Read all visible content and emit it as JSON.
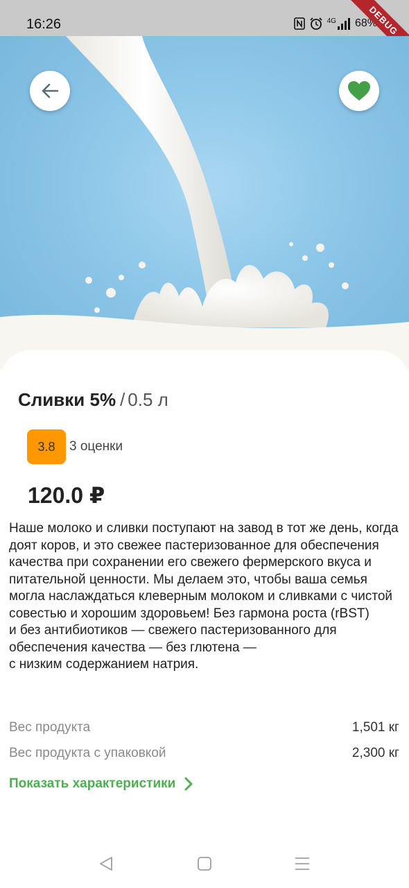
{
  "status_bar": {
    "time": "16:26",
    "network": "4G",
    "battery": "68%",
    "debug_label": "DEBUG",
    "icons": [
      "nfc-icon",
      "alarm-icon",
      "signal-icon",
      "battery-icon"
    ]
  },
  "hero": {
    "image": "milk-splash-image",
    "back_icon": "arrow-left-icon",
    "favorite_icon": "heart-icon"
  },
  "product": {
    "name": "Сливки 5%",
    "separator": "/",
    "volume": "0.5 л",
    "rating": "3.8",
    "rating_count": "3 оценки",
    "price": "120.0 ₽",
    "description": "Наше молоко и сливки поступают на завод в тот же день, когда доят коров, и это свежее пастеризованное для обеспечения качества при сохранении его свежего фермерского вкуса и питательной ценности. Мы делаем это, чтобы ваша семья могла наслаждаться клеверным молоком и сливками с чистой совестью и хорошим здоровьем! Без гармона роста (rBST)\nи без антибиотиков — свежего пастеризованного для обеспечения качества — без глютена —\nс низким содержанием натрия."
  },
  "specs": [
    {
      "label": "Вес продукта",
      "value": "1,501 кг"
    },
    {
      "label": "Вес продукта с упаковкой",
      "value": "2,300 кг"
    }
  ],
  "show_specs_label": "Показать характеристики",
  "colors": {
    "accent_green": "#4caf50",
    "rating_orange": "#ff9800",
    "hero_blue": "#8cc6e8"
  },
  "nav": [
    "nav-back-icon",
    "nav-home-icon",
    "nav-menu-icon"
  ]
}
